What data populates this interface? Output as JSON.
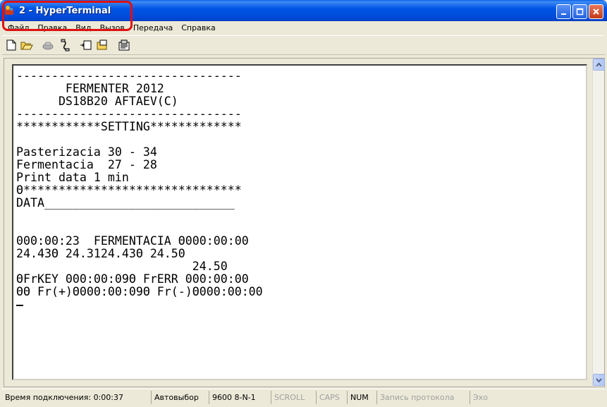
{
  "window": {
    "title": "2 - HyperTerminal",
    "icon": "hyperterminal-icon"
  },
  "menu": [
    {
      "label": "Файл"
    },
    {
      "label": "Правка"
    },
    {
      "label": "Вид"
    },
    {
      "label": "Вызов"
    },
    {
      "label": "Передача"
    },
    {
      "label": "Справка"
    }
  ],
  "toolbar": {
    "buttons": [
      "new-icon",
      "open-icon",
      "disconnect-icon",
      "connect-icon",
      "send-icon",
      "receive-icon",
      "properties-icon"
    ]
  },
  "terminal": {
    "lines": [
      "--------------------------------",
      "       FERMENTER 2012",
      "      DS18B20 AFTAEV(C)",
      "--------------------------------",
      "************SETTING*************",
      "",
      "Pasterizacia 30 - 34",
      "Fermentacia  27 - 28",
      "Print data 1 min",
      "Θ*******************************",
      "DATA___________________________",
      "",
      "",
      "000:00:23  FERMENTACIA Θ000:00:00",
      "24.43Θ 24.3124.43Θ 24.50",
      "                         24.50",
      "ΘFrKEY 000:00:09Θ FrERR 000:00:00",
      "ΘΘ Fr(+)Θ000:00:09Θ Fr(-)Θ000:00:00"
    ]
  },
  "statusbar": {
    "connection_time": "Время подключения: 0:00:37",
    "detect": "Автовыбор",
    "settings": "9600 8-N-1",
    "scroll": "SCROLL",
    "caps": "CAPS",
    "num": "NUM",
    "capture": "Запись протокола",
    "echo": "Эхо"
  },
  "colors": {
    "titlebar": "#0055e5",
    "highlight": "#e01010"
  }
}
